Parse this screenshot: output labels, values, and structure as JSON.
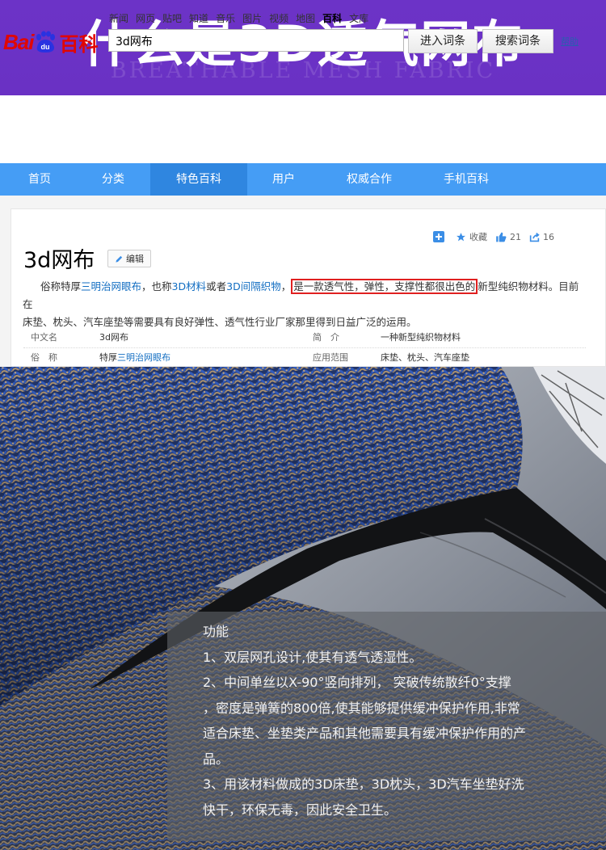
{
  "banner": {
    "title": "什么是3D透气网布",
    "subtitle": "BREATHABLE MESH FABRIC"
  },
  "baidu": {
    "logo_text": "Bai",
    "logo_du": "du",
    "logo_baike": "百科",
    "nav_links": [
      "新闻",
      "网页",
      "贴吧",
      "知道",
      "音乐",
      "图片",
      "视频",
      "地图",
      "百科",
      "文库"
    ],
    "active_nav": "百科",
    "search_value": "3d网布",
    "enter_button": "进入词条",
    "search_button": "搜索词条",
    "help_link": "帮助"
  },
  "main_nav": {
    "tabs": [
      "首页",
      "分类",
      "特色百科",
      "用户",
      "权威合作",
      "手机百科"
    ],
    "active": "特色百科"
  },
  "entry": {
    "title": "3d网布",
    "edit_label": "编辑",
    "actions": {
      "collect_label": "收藏",
      "like_count": "21",
      "share_count": "16"
    },
    "summary": {
      "p1": "俗称特厚",
      "link1": "三明治网眼布",
      "p2": "，也称",
      "link2": "3D材料",
      "p3": "或者",
      "link3": "3D间隔织物",
      "p4": "，",
      "highlight": "是一款透气性，弹性，支撑性都很出色的",
      "p5": "新型纯织物材料。目前在",
      "p6": "床垫、枕头、汽车座垫等需要具有良好弹性、透气性行业厂家那里得到日益广泛的运用。"
    },
    "info": {
      "r1": {
        "k1": "中文名",
        "v1": "3d网布",
        "k2": "简　介",
        "v2": "一种新型纯织物材料"
      },
      "r2": {
        "k1": "俗　称",
        "v1_prefix": "特厚",
        "v1_link": "三明治网眼布",
        "k2": "应用范围",
        "v2": "床垫、枕头、汽车座垫"
      }
    }
  },
  "function_box": {
    "heading": "功能",
    "lines": [
      "1、双层网孔设计,使其有透气透湿性。",
      "2、中间单丝以X-90°竖向排列， 突破传统散纤0°支撑",
      "，密度是弹簧的800倍,使其能够提供缓冲保护作用,非常",
      "适合床垫、坐垫类产品和其他需要具有缓冲保护作用的产",
      "品。",
      "3、用该材料做成的3D床垫，3D枕头，3D汽车坐垫好洗",
      "快干，环保无毒，因此安全卫生。"
    ]
  },
  "colors": {
    "banner": "#6c33c7",
    "baidu_red": "#e10601",
    "baidu_blue": "#2932e1",
    "nav_blue": "#459df5",
    "link_blue": "#136ec2",
    "highlight_red": "#e02020",
    "fabric_blue": "#2f57b8",
    "fabric_tan": "#b89d78"
  }
}
